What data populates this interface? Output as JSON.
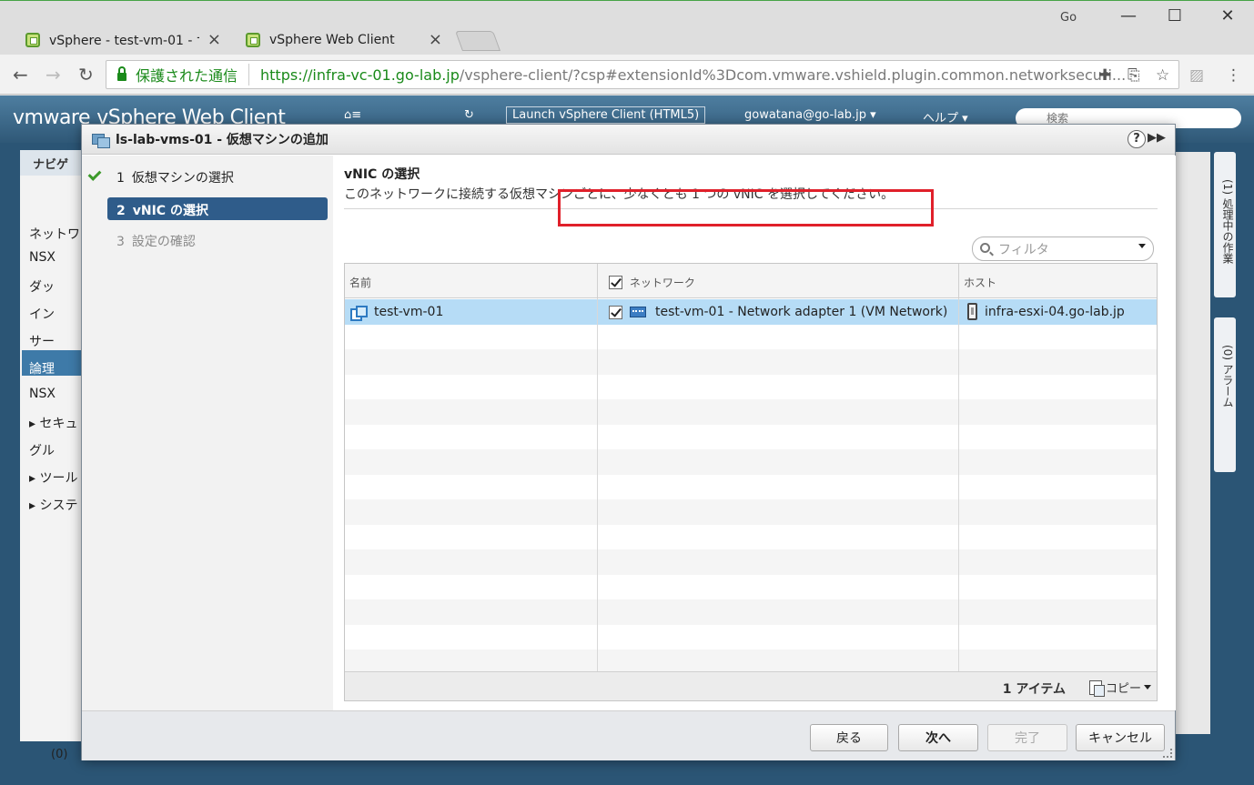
{
  "browser": {
    "tabs": [
      {
        "title": "vSphere - test-vm-01 - サ",
        "active": false
      },
      {
        "title": "vSphere Web Client",
        "active": true
      }
    ],
    "profile_name": "Go",
    "security_label": "保護された通信",
    "url_host": "https://infra-vc-01.go-lab.jp",
    "url_path": "/vsphere-client/?csp#extensionId%3Dcom.vmware.vshield.plugin.common.networksecuri..."
  },
  "vsphere": {
    "logo_brand": "vm",
    "logo_ware": "ware",
    "product": "vSphere Web Client",
    "launch_label": "Launch vSphere Client (HTML5)",
    "user": "gowatana@go-lab.jp ▾",
    "help_menu": "ヘルプ ▾",
    "search_placeholder": "検索",
    "nav_header": "ナビゲ",
    "nav_items": [
      "ネットワ",
      "NSX",
      "ダッ",
      "イン",
      "サー",
      "論理",
      "NSX",
      "▸ セキュ",
      "グル",
      "▸ ツール",
      "▸ システ"
    ],
    "side_tabs": [
      "(1) 処理中の作業",
      "(0) アラーム"
    ],
    "status_text": "(0)"
  },
  "dialog": {
    "title": "ls-lab-vms-01 - 仮想マシンの追加",
    "help_label": "?",
    "steps": [
      {
        "num": "1",
        "label": "仮想マシンの選択",
        "state": "done"
      },
      {
        "num": "2",
        "label": "vNIC の選択",
        "state": "active"
      },
      {
        "num": "3",
        "label": "設定の確認",
        "state": "pending"
      }
    ],
    "content_title": "vNIC の選択",
    "content_desc": "このネットワークに接続する仮想マシンごとに、少なくとも 1 つの vNIC を選択してください。",
    "filter_placeholder": "フィルタ",
    "columns": {
      "name": "名前",
      "network": "ネットワーク",
      "host": "ホスト"
    },
    "rows": [
      {
        "name": "test-vm-01",
        "network": "test-vm-01 - Network adapter 1 (VM Network)",
        "checked": true,
        "host": "infra-esxi-04.go-lab.jp"
      }
    ],
    "item_count": "1 アイテム",
    "copy_label": "コピー",
    "buttons": {
      "back": "戻る",
      "next": "次へ",
      "finish": "完了",
      "cancel": "キャンセル"
    }
  }
}
